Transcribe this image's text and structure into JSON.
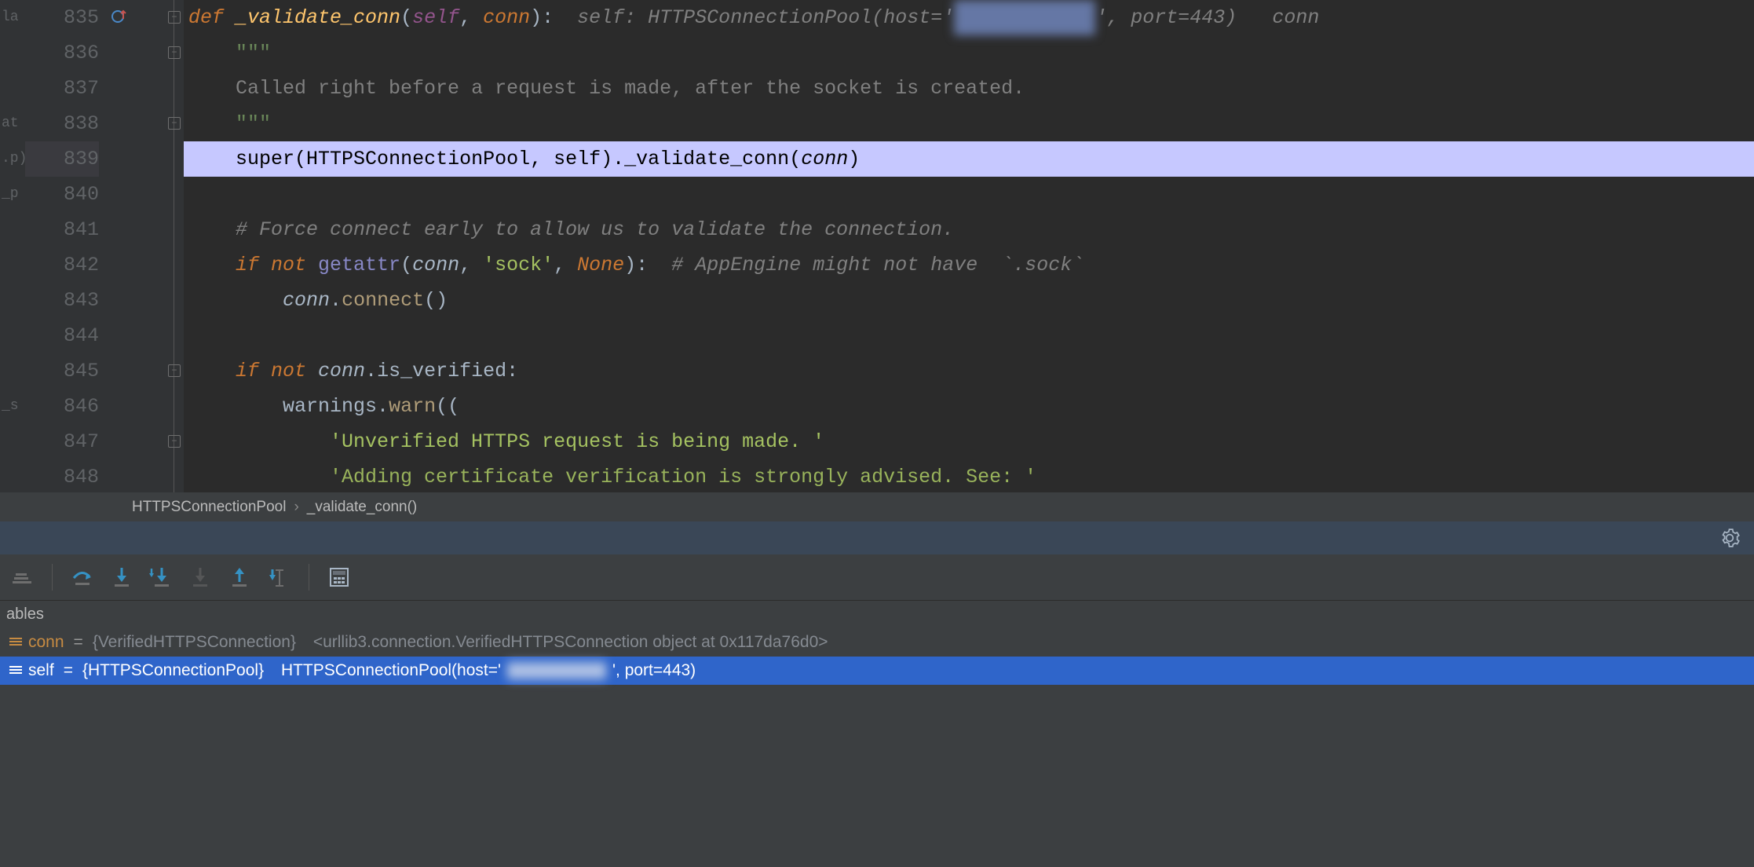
{
  "left_margin_labels": [
    "la",
    "",
    "",
    "at",
    ".p)",
    "_p",
    "",
    "",
    "",
    "",
    "",
    "_s",
    ""
  ],
  "line_numbers": [
    "835",
    "836",
    "837",
    "838",
    "839",
    "840",
    "841",
    "842",
    "843",
    "844",
    "845",
    "846",
    "847",
    "848"
  ],
  "code": {
    "l835": {
      "kw_def": "def ",
      "name": "_validate_conn",
      "paren_open": "(",
      "self": "self",
      "comma": ", ",
      "conn": "conn",
      "paren_close": "):",
      "hint_self_label": "  self: ",
      "hint_self_val_pre": "HTTPSConnectionPool(host='",
      "hint_self_obscured": "xxxxxxxxxxxx",
      "hint_self_val_post": "', port=443)",
      "hint_conn": "   conn"
    },
    "l836": {
      "docq": "\"\"\""
    },
    "l837": {
      "doc": "Called right before a request is made, after the socket is created."
    },
    "l838": {
      "docq": "\"\"\""
    },
    "l839": {
      "super": "super",
      "open": "(",
      "cls": "HTTPSConnectionPool",
      "c1": ", ",
      "self": "self",
      "close": ").",
      "call": "_validate_conn",
      "op2": "(",
      "arg": "conn",
      "cl2": ")"
    },
    "l841": {
      "cmt": "# Force connect early to allow us to validate the connection."
    },
    "l842": {
      "if": "if ",
      "not": "not ",
      "ga": "getattr",
      "open": "(",
      "conn": "conn",
      "c1": ", ",
      "s1": "'sock'",
      "c2": ", ",
      "none": "None",
      "close": "):",
      "cmt": "  # AppEngine might not have  `.sock`"
    },
    "l843": {
      "conn": "conn",
      "dot": ".",
      "call": "connect",
      "p": "()"
    },
    "l845": {
      "if": "if ",
      "not": "not ",
      "conn": "conn",
      "rest": ".is_verified:"
    },
    "l846": {
      "warnings": "warnings.",
      "warn": "warn",
      "p": "(("
    },
    "l847": {
      "s": "'Unverified HTTPS request is being made. '"
    },
    "l848": {
      "s": "'Adding certificate verification is strongly advised. See: '"
    }
  },
  "breadcrumb": {
    "class": "HTTPSConnectionPool",
    "method": "_validate_conn()"
  },
  "variables_header": "ables",
  "variables": [
    {
      "name": "conn",
      "type": "{VerifiedHTTPSConnection}",
      "value": "<urllib3.connection.VerifiedHTTPSConnection object at 0x117da76d0>",
      "selected": false
    },
    {
      "name": "self",
      "type": "{HTTPSConnectionPool}",
      "value_pre": "HTTPSConnectionPool(host='",
      "value_obscured": "xxxxxxxxxxxx",
      "value_post": "', port=443)",
      "selected": true
    }
  ]
}
